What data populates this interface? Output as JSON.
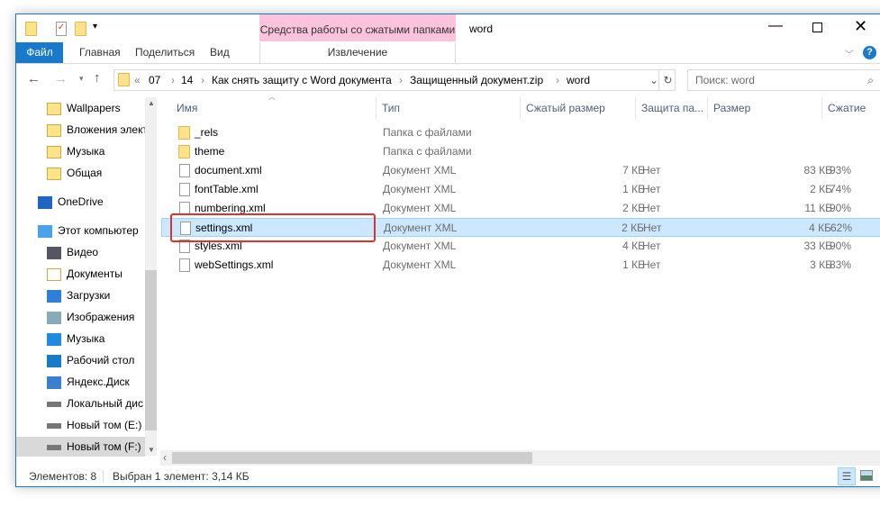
{
  "title": "word",
  "context_tab_group": "Средства работы со сжатыми папками",
  "ribbon_tabs": [
    "Файл",
    "Главная",
    "Поделиться",
    "Вид",
    "Извлечение"
  ],
  "breadcrumb": [
    "«",
    "07",
    "14",
    "Как снять защиту с Word документа",
    "Защищенный документ.zip",
    "word"
  ],
  "search_placeholder": "Поиск: word",
  "nav": [
    "Wallpapers",
    "Вложения элект",
    "Музыка",
    "Общая",
    "OneDrive",
    "Этот компьютер",
    "Видео",
    "Документы",
    "Загрузки",
    "Изображения",
    "Музыка",
    "Рабочий стол",
    "Яндекс.Диск",
    "Локальный дис",
    "Новый том (E:)",
    "Новый том (F:)"
  ],
  "columns": [
    "Имя",
    "Тип",
    "Сжатый размер",
    "Защита па...",
    "Размер",
    "Сжатие"
  ],
  "files": [
    {
      "name": "_rels",
      "type": "Папка с файлами",
      "csize": "",
      "prot": "",
      "size": "",
      "ratio": "",
      "folder": true
    },
    {
      "name": "theme",
      "type": "Папка с файлами",
      "csize": "",
      "prot": "",
      "size": "",
      "ratio": "",
      "folder": true
    },
    {
      "name": "document.xml",
      "type": "Документ XML",
      "csize": "7 КБ",
      "prot": "Нет",
      "size": "83 КБ",
      "ratio": "93%"
    },
    {
      "name": "fontTable.xml",
      "type": "Документ XML",
      "csize": "1 КБ",
      "prot": "Нет",
      "size": "2 КБ",
      "ratio": "74%"
    },
    {
      "name": "numbering.xml",
      "type": "Документ XML",
      "csize": "2 КБ",
      "prot": "Нет",
      "size": "11 КБ",
      "ratio": "90%"
    },
    {
      "name": "settings.xml",
      "type": "Документ XML",
      "csize": "2 КБ",
      "prot": "Нет",
      "size": "4 КБ",
      "ratio": "62%",
      "selected": true
    },
    {
      "name": "styles.xml",
      "type": "Документ XML",
      "csize": "4 КБ",
      "prot": "Нет",
      "size": "33 КБ",
      "ratio": "90%"
    },
    {
      "name": "webSettings.xml",
      "type": "Документ XML",
      "csize": "1 КБ",
      "prot": "Нет",
      "size": "3 КБ",
      "ratio": "83%"
    }
  ],
  "status": {
    "count": "Элементов: 8",
    "selection": "Выбран 1 элемент: 3,14 КБ"
  },
  "colors": {
    "accent": "#1979ca",
    "context": "#fbc4dc",
    "selection": "#cce8ff",
    "highlight": "#e0312b"
  }
}
